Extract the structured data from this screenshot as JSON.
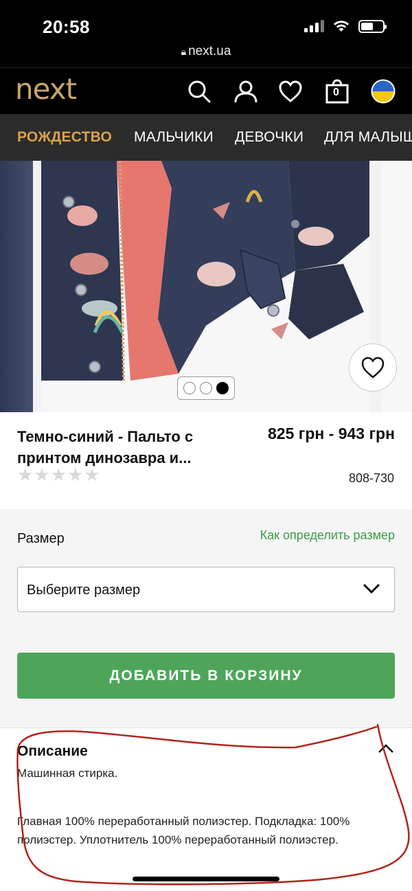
{
  "status": {
    "time": "20:58",
    "url": "next.ua"
  },
  "header": {
    "logo": "next",
    "cart_count": "0"
  },
  "nav": {
    "items": [
      "РОЖДЕСТВО",
      "МАЛЬЧИКИ",
      "ДЕВОЧКИ",
      "ДЛЯ МАЛЫШ"
    ]
  },
  "product": {
    "title": "Темно-синий - Пальто с принтом динозавра и...",
    "price": "825 грн - 943 грн",
    "code": "808-730",
    "rating": 0,
    "gallery_dots": 3,
    "gallery_active_index": 2
  },
  "size": {
    "label": "Размер",
    "guide_link": "Как определить размер",
    "select_value": "Выберите размер"
  },
  "cta": {
    "add_to_cart": "ДОБАВИТЬ В КОРЗИНУ"
  },
  "description": {
    "title": "Описание",
    "line1": "Машинная стирка.",
    "line2": "Главная 100% переработанный полиэстер. Подкладка: 100% полиэстер. Уплотнитель 100% переработанный полиэстер."
  },
  "colors": {
    "brand_gold": "#c7a66b",
    "nav_active": "#d9a24c",
    "cta_green": "#4ea55a",
    "link_green": "#3c9a48",
    "annotation_red": "#b0241c"
  },
  "icons": [
    "lock-icon",
    "search-icon",
    "account-icon",
    "heart-icon",
    "bag-icon",
    "flag-icon",
    "chevron-down-icon",
    "chevron-up-icon"
  ]
}
